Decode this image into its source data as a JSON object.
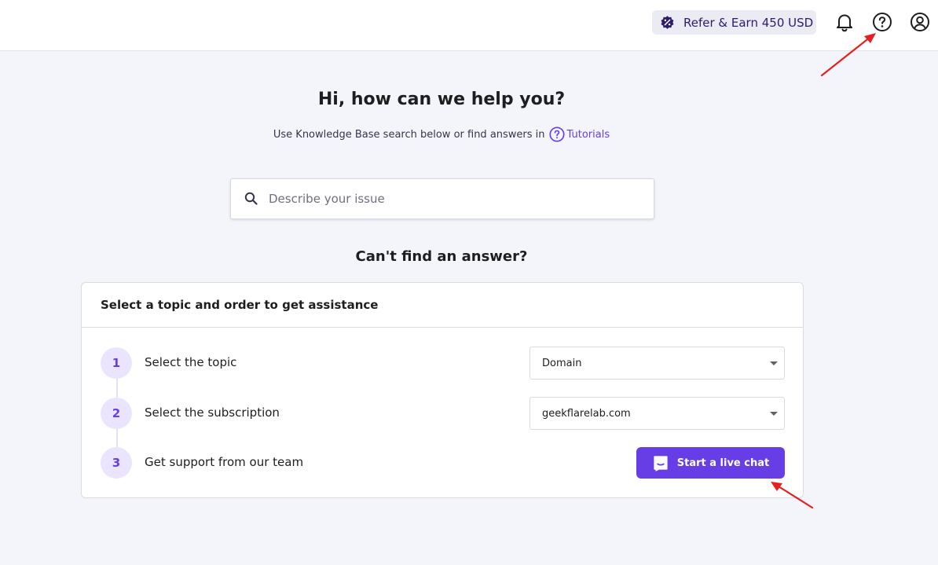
{
  "header": {
    "refer_label": "Refer & Earn 450 USD",
    "icons": [
      "discount-badge-icon",
      "bell-icon",
      "help-circle-icon",
      "user-circle-icon"
    ]
  },
  "hero": {
    "title": "Hi, how can we help you?",
    "subtitle": "Use Knowledge Base search below or find answers in",
    "tutorials_link": "Tutorials"
  },
  "search": {
    "placeholder": "Describe your issue",
    "value": ""
  },
  "assistance": {
    "heading": "Can't find an answer?",
    "card_title": "Select a topic and order to get assistance",
    "steps": [
      {
        "number": "1",
        "label": "Select the topic",
        "selected": "Domain"
      },
      {
        "number": "2",
        "label": "Select the subscription",
        "selected": "geekflarelab.com"
      },
      {
        "number": "3",
        "label": "Get support from our team"
      }
    ],
    "chat_button": "Start a live chat"
  },
  "colors": {
    "accent": "#673de6",
    "page_bg": "#f4f4fb",
    "annotation_arrow": "#e5201f"
  }
}
